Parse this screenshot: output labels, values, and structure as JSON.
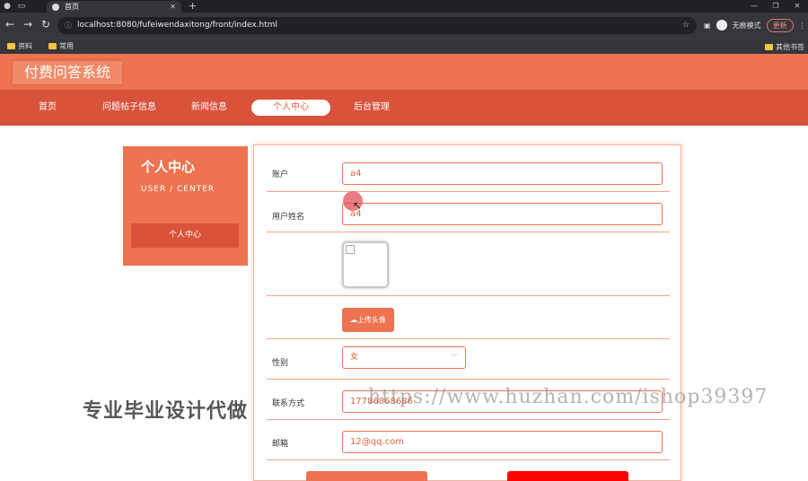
{
  "browser": {
    "tab_title": "首页",
    "url": "localhost:8080/fufeiwendaxitong/front/index.html",
    "profile_label": "无痕模式",
    "update_label": "更新",
    "bookmarks": [
      "资料",
      "常用"
    ],
    "bookmarks_right": "其他书签"
  },
  "site": {
    "logo": "付费问答系统",
    "nav": [
      {
        "label": "首页"
      },
      {
        "label": "问题帖子信息"
      },
      {
        "label": "新闻信息"
      },
      {
        "label": "个人中心"
      },
      {
        "label": "后台管理"
      }
    ],
    "active_nav": "个人中心"
  },
  "sidebar": {
    "title": "个人中心",
    "subtitle": "USER / CENTER",
    "button": "个人中心"
  },
  "form": {
    "account_label": "账户",
    "account_value": "a4",
    "name_label": "用户姓名",
    "name_value": "a4",
    "upload_label": "上传头像",
    "gender_label": "性别",
    "gender_value": "女",
    "phone_label": "联系方式",
    "phone_value": "17786868686",
    "email_label": "邮箱",
    "email_value": "12@qq.com"
  },
  "overlay": {
    "watermark_left": "专业毕业设计代做",
    "watermark_right": "https://www.huzhan.com/ishop39397"
  },
  "colors": {
    "brand": "#ee7350",
    "nav": "#d9523a",
    "danger": "#ff0000"
  }
}
